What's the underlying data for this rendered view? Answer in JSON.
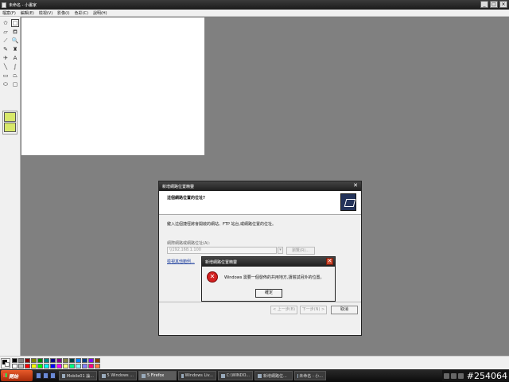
{
  "window": {
    "title": "未命名 - 小畫家",
    "controls": [
      "_",
      "□",
      "×"
    ]
  },
  "menu": [
    "檔案(F)",
    "編輯(E)",
    "檢視(V)",
    "影像(I)",
    "色彩(C)",
    "說明(H)"
  ],
  "tools": [
    {
      "name": "free-select-icon",
      "glyph": "✩"
    },
    {
      "name": "rect-select-icon",
      "glyph": "□"
    },
    {
      "name": "eraser-icon",
      "glyph": "▱"
    },
    {
      "name": "fill-bucket-icon",
      "glyph": "⛾"
    },
    {
      "name": "color-picker-icon",
      "glyph": "⟋"
    },
    {
      "name": "magnifier-icon",
      "glyph": "🔍"
    },
    {
      "name": "pencil-icon",
      "glyph": "✎"
    },
    {
      "name": "brush-icon",
      "glyph": "♜"
    },
    {
      "name": "airbrush-icon",
      "glyph": "✈"
    },
    {
      "name": "text-icon",
      "glyph": "A"
    },
    {
      "name": "line-icon",
      "glyph": "╲"
    },
    {
      "name": "curve-icon",
      "glyph": "∫"
    },
    {
      "name": "rectangle-icon",
      "glyph": "▭"
    },
    {
      "name": "polygon-icon",
      "glyph": "⏢"
    },
    {
      "name": "ellipse-icon",
      "glyph": "⬭"
    },
    {
      "name": "rounded-rect-icon",
      "glyph": "▢"
    }
  ],
  "palette": [
    "#000000",
    "#808080",
    "#800000",
    "#808000",
    "#008000",
    "#008080",
    "#000080",
    "#800080",
    "#808040",
    "#004040",
    "#0080ff",
    "#004080",
    "#8000ff",
    "#804000",
    "#ffffff",
    "#c0c0c0",
    "#ff0000",
    "#ffff00",
    "#00ff00",
    "#00ffff",
    "#0000ff",
    "#ff00ff",
    "#ffff80",
    "#00ff80",
    "#80ffff",
    "#8080ff",
    "#ff0080",
    "#ff8040"
  ],
  "wizard": {
    "title": "新增網路位置精靈",
    "heading": "這個網路位置的位址?",
    "description": "鍵入這個捷徑將會開啟的網站、FTP 站台,或網路位置的位址。",
    "address_label": "網際網路或網路位址(A):",
    "address_value": "\\\\192.168.1.100",
    "browse_label": "瀏覽(R)...",
    "examples_link": "檢視其他範例...",
    "back_label": "< 上一步(B)",
    "next_label": "下一步(N) >",
    "cancel_label": "取消"
  },
  "error_dialog": {
    "title": "新增網路位置精靈",
    "message": "Windows 需要一個發佈的共用地方,請嘗試另外的位置。",
    "ok_label": "確定"
  },
  "taskbar": {
    "start_label": "開始",
    "tasks": [
      {
        "label": "Mobile01 論...",
        "active": false
      },
      {
        "label": "5 Windows ...",
        "active": false
      },
      {
        "label": "5 Firefox",
        "active": true
      },
      {
        "label": "Windows Liv...",
        "active": false
      },
      {
        "label": "C:\\WINDO...",
        "active": false
      },
      {
        "label": "新增網路位...",
        "active": false
      },
      {
        "label": "未命名 - 小...",
        "active": false
      }
    ],
    "watermark": "#254064"
  }
}
